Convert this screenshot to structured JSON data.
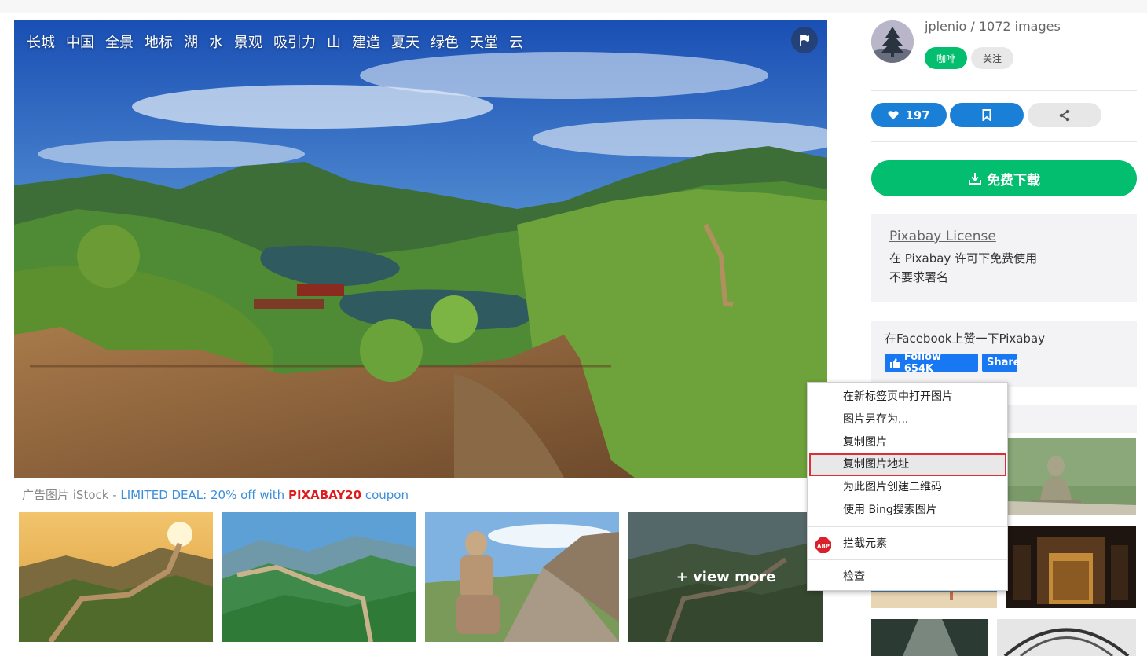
{
  "photo": {
    "tags": [
      "长城",
      "中国",
      "全景",
      "地标",
      "湖",
      "水",
      "景观",
      "吸引力",
      "山",
      "建造",
      "夏天",
      "绿色",
      "天堂",
      "云"
    ]
  },
  "ad": {
    "prefix": "广告图片 iStock - ",
    "deal": "LIMITED DEAL: 20% off with ",
    "code": "PIXABAY20",
    "suffix": " coupon"
  },
  "related": {
    "view_more": "+ view more"
  },
  "author": {
    "name": "jplenio / 1072 images",
    "coffee_label": "咖啡",
    "follow_label": "关注"
  },
  "actions": {
    "likes": "197"
  },
  "download": {
    "label": "免费下载"
  },
  "license": {
    "title": "Pixabay License",
    "line1": "在 Pixabay 许可下免费使用",
    "line2": "不要求署名"
  },
  "facebook": {
    "text": "在Facebook上赞一下Pixabay",
    "follow": "Follow 654K",
    "share": "Share"
  },
  "context_menu": {
    "items": [
      "在新标签页中打开图片",
      "图片另存为...",
      "复制图片",
      "复制图片地址",
      "为此图片创建二维码",
      "使用 Bing搜索图片",
      "拦截元素",
      "检查"
    ],
    "highlighted": "复制图片地址"
  },
  "colors": {
    "green": "#02be6e",
    "blue": "#1a7fd6",
    "highlight_border": "#d93035",
    "coupon": "#e01b1b",
    "link": "#3d8ed8"
  }
}
